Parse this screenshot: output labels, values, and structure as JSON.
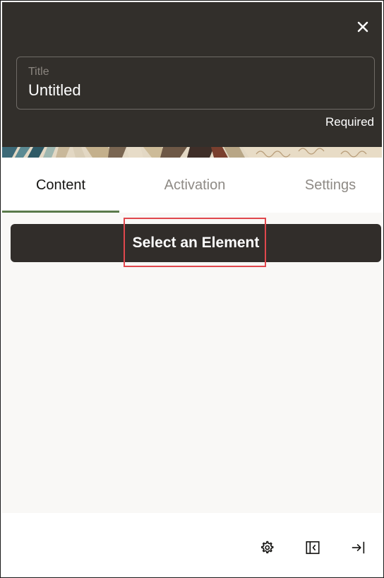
{
  "header": {
    "title_label": "Title",
    "title_value": "Untitled",
    "required_text": "Required",
    "close_icon": "close-icon"
  },
  "tabs": [
    {
      "label": "Content",
      "active": true
    },
    {
      "label": "Activation",
      "active": false
    },
    {
      "label": "Settings",
      "active": false
    }
  ],
  "content": {
    "select_button_label": "Select an Element"
  },
  "footer": {
    "icons": [
      "gear-icon",
      "collapse-panel-icon",
      "exit-icon"
    ]
  },
  "colors": {
    "header_bg": "#322f2b",
    "button_bg": "#312d2a",
    "tab_active_underline": "#5a7a4a",
    "highlight": "#e0474d"
  }
}
